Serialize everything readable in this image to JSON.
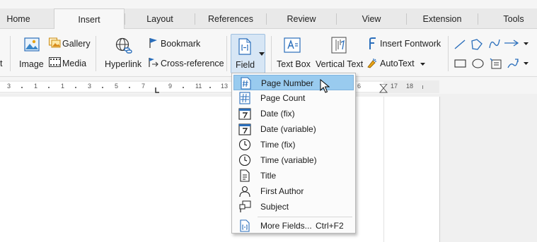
{
  "tabs": [
    {
      "label": "Home",
      "ul": "H",
      "rest": "ome"
    },
    {
      "label": "Insert",
      "ul": "I",
      "rest": "nsert"
    },
    {
      "label": "Layout",
      "ul": "L",
      "rest": "ayout"
    },
    {
      "label": "References",
      "pre": "Refe",
      "ul": "r",
      "rest": "ences"
    },
    {
      "label": "Review",
      "ul": "R",
      "rest": "eview"
    },
    {
      "label": "View",
      "ul": "V",
      "rest": "iew"
    },
    {
      "label": "Extension",
      "ul": "E",
      "rest": "xtension"
    },
    {
      "label": "Tools",
      "ul": "T",
      "rest": "ools"
    }
  ],
  "ribbon": {
    "partial_label": "t",
    "gallery": "Gallery",
    "image": "Image",
    "media": "Media",
    "hyperlink": "Hyperlink",
    "bookmark": "Bookmark",
    "cross_reference": "Cross-reference",
    "field": "Field",
    "text_box": "Text Box",
    "vertical_text": "Vertical Text",
    "insert_fontwork": "Insert Fontwork",
    "autotext": "AutoText"
  },
  "ruler": {
    "ticks": [
      "3",
      "1",
      "1",
      "3",
      "5",
      "7",
      "9",
      "11",
      "13",
      "15",
      "6",
      "17",
      "18"
    ]
  },
  "field_menu": {
    "items": [
      {
        "label": "Page Number",
        "icon": "page-number-icon",
        "highlighted": true
      },
      {
        "label": "Page Count",
        "icon": "page-count-icon"
      },
      {
        "label": "Date (fix)",
        "icon": "calendar-icon"
      },
      {
        "label": "Date (variable)",
        "icon": "calendar-icon"
      },
      {
        "label": "Time (fix)",
        "icon": "clock-icon"
      },
      {
        "label": "Time (variable)",
        "icon": "clock-icon"
      },
      {
        "label": "Title",
        "icon": "document-icon"
      },
      {
        "label": "First Author",
        "icon": "person-icon"
      },
      {
        "label": "Subject",
        "icon": "subject-icon"
      }
    ],
    "more_fields": {
      "label": "More Fields...",
      "shortcut": "Ctrl+F2",
      "icon": "field-icon"
    }
  },
  "colors": {
    "highlight": "#99cbef",
    "accent_blue": "#2a6ebb"
  }
}
